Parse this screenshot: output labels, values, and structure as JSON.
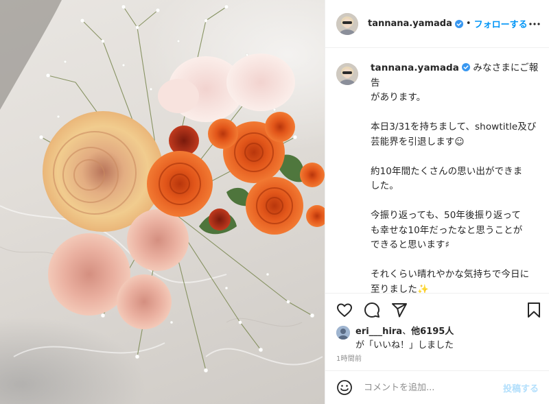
{
  "colors": {
    "accent": "#0095f6",
    "post_disabled": "#b2dffc",
    "text": "#262626",
    "muted": "#8e8e8e",
    "border": "#efefef"
  },
  "photo": {
    "subject": "flower-bouquet"
  },
  "header": {
    "username": "tannana.yamada",
    "separator": "•",
    "follow_label": "フォローする",
    "more_icon": "more-horizontal-icon",
    "verified_icon": "verified-badge-icon"
  },
  "caption": {
    "username": "tannana.yamada",
    "text": "みなさまにご報告\nがあります。\n\n本日3/31を持ちまして、showtitle及び\n芸能界を引退します☺︎\n\n約10年間たくさんの思い出ができま\nした。\n\n今振り返っても、50年後振り返って\nも幸せな10年だったなと思うことが\nできると思います♯\n\nそれくらい晴れやかな気持ちで今日に\n至りました✨\n\n引退すると言っても、せっかくの繋が\nりなのでこのInstagramや他のSNSは\n続けていこうと思っておりますので"
  },
  "actions": {
    "like_icon": "heart-icon",
    "comment_icon": "comment-icon",
    "share_icon": "share-icon",
    "save_icon": "bookmark-icon"
  },
  "likes": {
    "user": "eri___hira",
    "joiner": "、",
    "others": "他6195人",
    "suffix": "が「いいね！」しました"
  },
  "time_ago": "1時間前",
  "comment": {
    "emoji_icon": "emoji-icon",
    "placeholder": "コメントを追加...",
    "post_label": "投稿する"
  }
}
